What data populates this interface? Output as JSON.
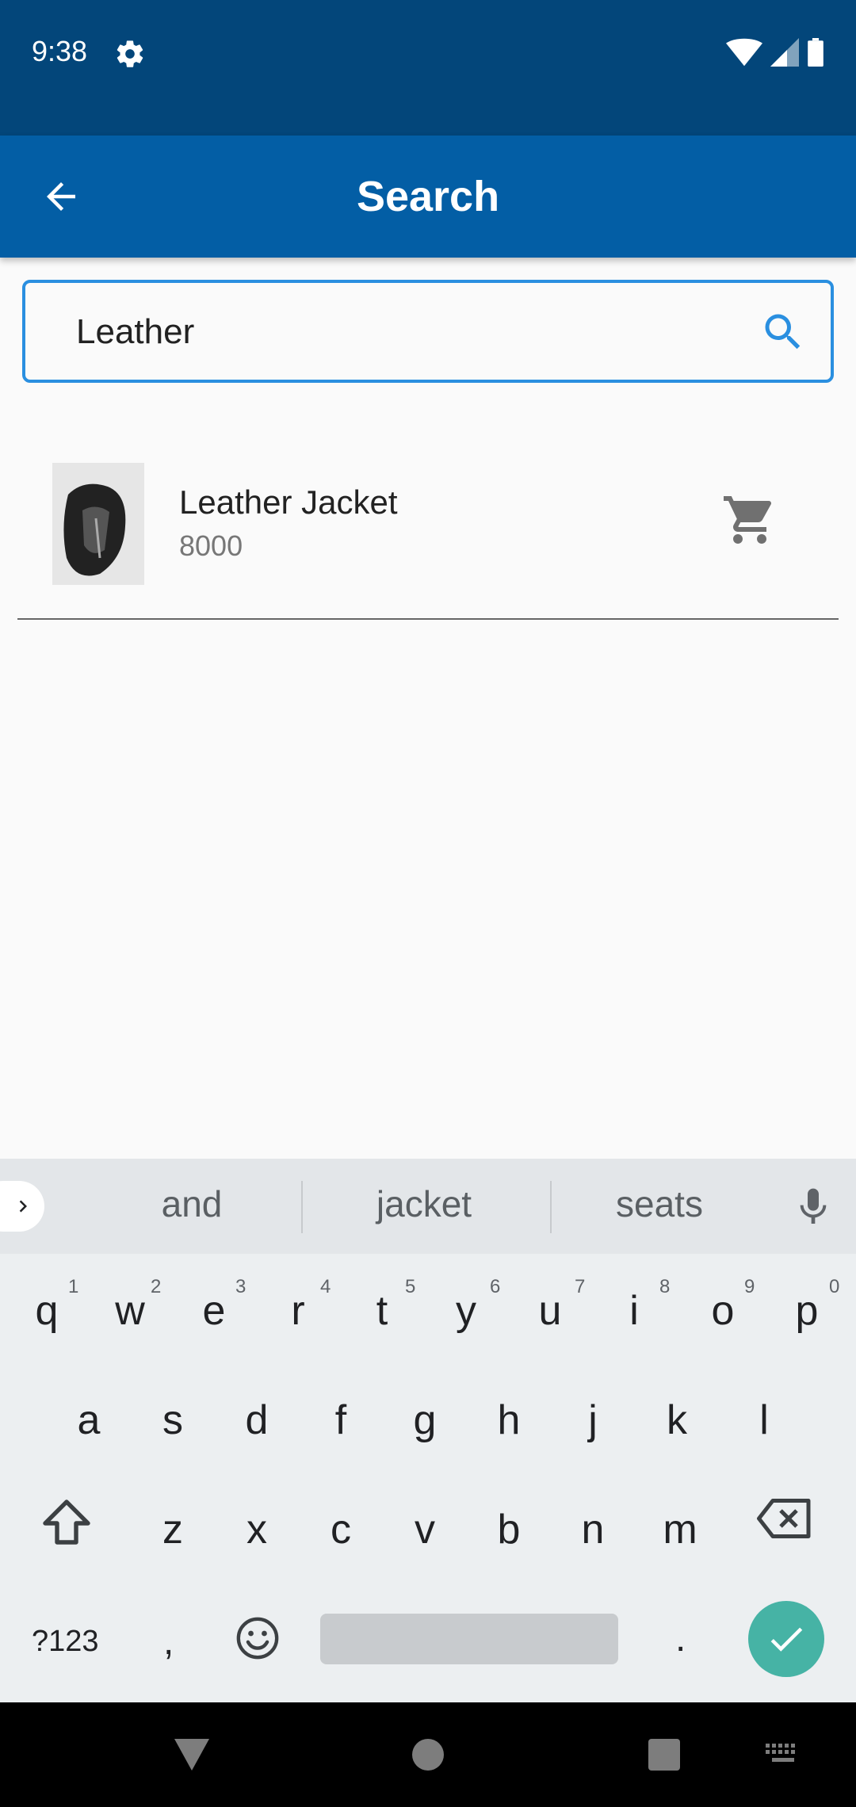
{
  "status_bar": {
    "time": "9:38"
  },
  "app_bar": {
    "title": "Search"
  },
  "search": {
    "value": "Leather"
  },
  "results": [
    {
      "name": "Leather Jacket",
      "price": "8000"
    }
  ],
  "keyboard": {
    "suggestions": [
      "and",
      "jacket",
      "seats"
    ],
    "row1": [
      {
        "k": "q",
        "n": "1"
      },
      {
        "k": "w",
        "n": "2"
      },
      {
        "k": "e",
        "n": "3"
      },
      {
        "k": "r",
        "n": "4"
      },
      {
        "k": "t",
        "n": "5"
      },
      {
        "k": "y",
        "n": "6"
      },
      {
        "k": "u",
        "n": "7"
      },
      {
        "k": "i",
        "n": "8"
      },
      {
        "k": "o",
        "n": "9"
      },
      {
        "k": "p",
        "n": "0"
      }
    ],
    "row2": [
      "a",
      "s",
      "d",
      "f",
      "g",
      "h",
      "j",
      "k",
      "l"
    ],
    "row3": [
      "z",
      "x",
      "c",
      "v",
      "b",
      "n",
      "m"
    ],
    "symbols_label": "?123",
    "comma": ",",
    "period": "."
  },
  "colors": {
    "status_bar": "#03467a",
    "app_bar": "#035ea5",
    "search_border": "#2a8fe0",
    "enter_key": "#46b3a5"
  }
}
